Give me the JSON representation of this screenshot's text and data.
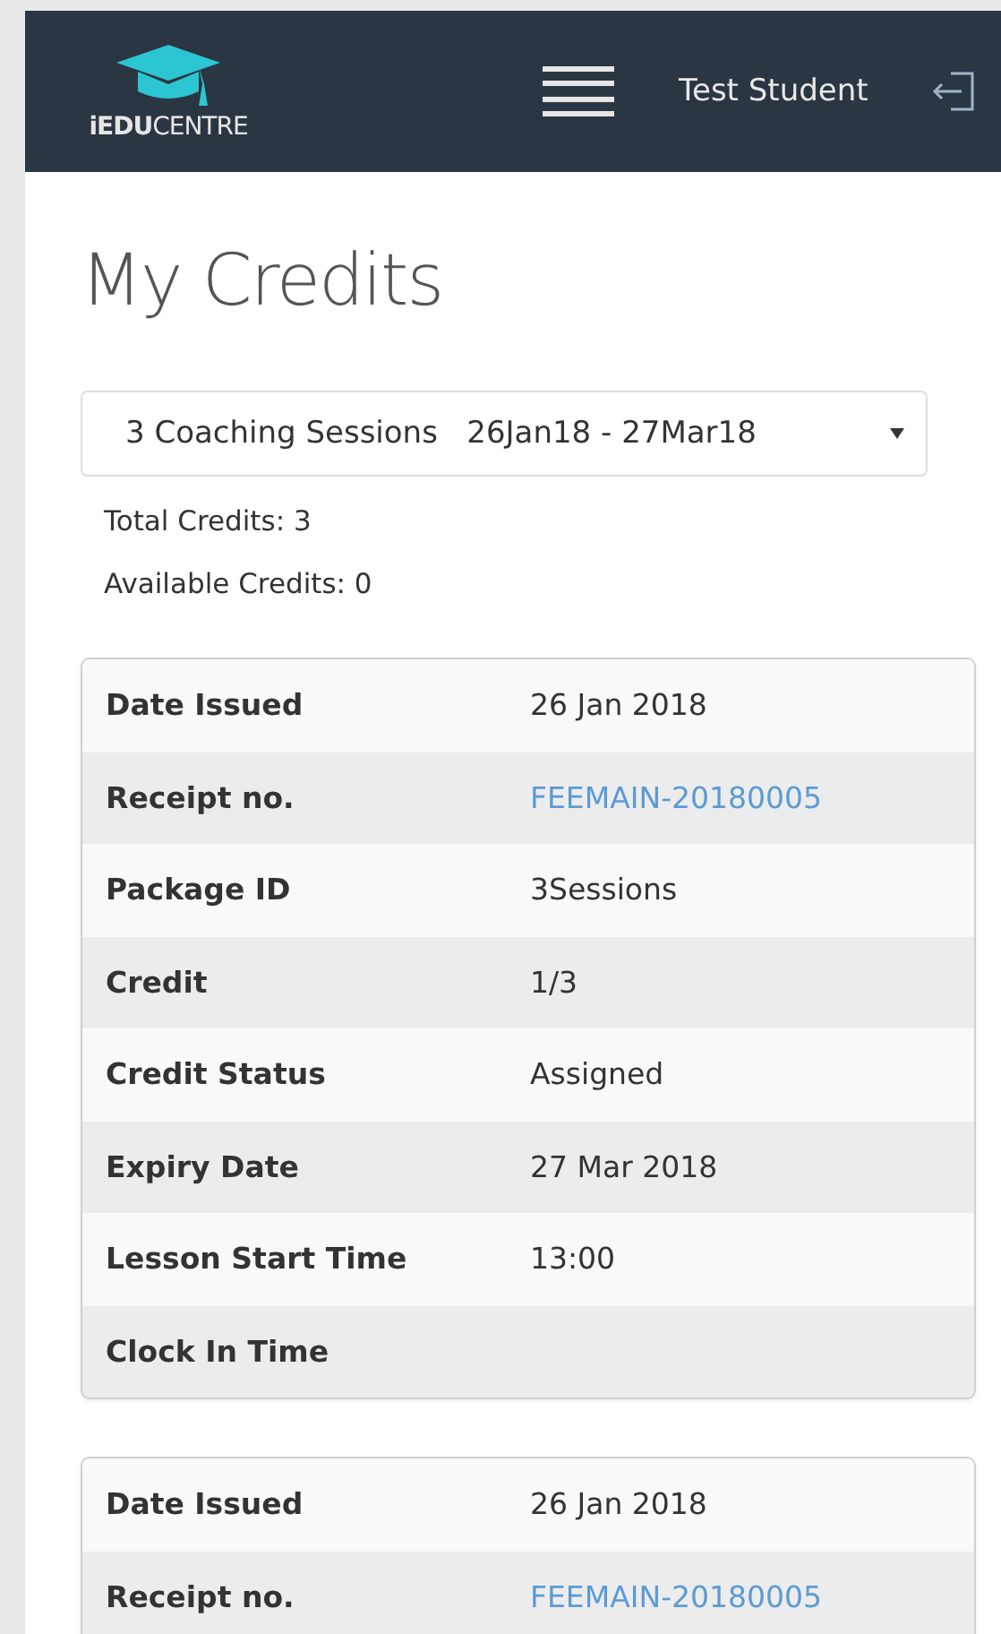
{
  "header": {
    "logo_text": "**iEDU**CENTRE",
    "user_name": "Test Student"
  },
  "page_title": "My Credits",
  "package_select": {
    "value": "3 Coaching Sessions   26Jan18 - 27Mar18"
  },
  "summary": [
    "Total Credits: 3",
    "Available Credits: 0"
  ],
  "credit_cards": [
    {
      "rows": [
        {
          "label": "Date Issued",
          "value": "26 Jan 2018",
          "kind": "text"
        },
        {
          "label": "Receipt no.",
          "value": "FEEMAIN-20180005",
          "kind": "link"
        },
        {
          "label": "Package ID",
          "value": "3Sessions",
          "kind": "text"
        },
        {
          "label": "Credit",
          "value": "1/3",
          "kind": "text"
        },
        {
          "label": "Credit Status",
          "value": "Assigned",
          "kind": "text"
        },
        {
          "label": "Expiry Date",
          "value": "27 Mar 2018",
          "kind": "text"
        },
        {
          "label": "Lesson Start Time",
          "value": "13:00",
          "kind": "text"
        },
        {
          "label": "Clock In Time"
        }
      ]
    },
    {
      "rows": [
        {
          "label": "Date Issued",
          "value": "26 Jan 2018",
          "kind": "text"
        },
        {
          "label": "Receipt no.",
          "value": "FEEMAIN-20180005",
          "kind": "link"
        }
      ]
    }
  ]
}
